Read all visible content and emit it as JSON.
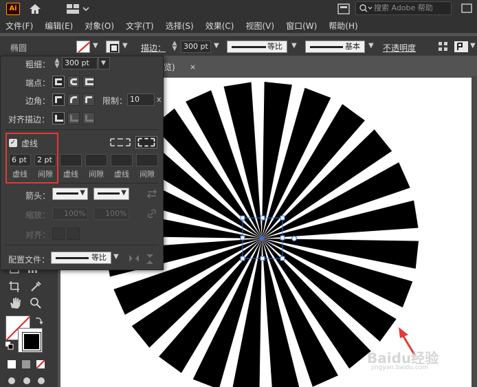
{
  "app": {
    "logo": "Ai",
    "search_placeholder": "搜索 Adobe 帮助",
    "icons": [
      "home-icon",
      "layout-switcher-icon",
      "search-icon",
      "panel-icon",
      "window-control-icon"
    ]
  },
  "menu": {
    "items": [
      "文件(F)",
      "编辑(E)",
      "对象(O)",
      "文字(T)",
      "选择(S)",
      "效果(C)",
      "视图(V)",
      "窗口(W)",
      "帮助(H)"
    ]
  },
  "control_bar": {
    "shape_name": "椭圆",
    "stroke_label": "描边：",
    "stroke_weight": "300 pt",
    "profile_label": "等比",
    "brush_label": "基本",
    "opacity_label": "不透明度"
  },
  "document_tab": {
    "title": "览)",
    "close": "×"
  },
  "stroke_panel": {
    "weight_label": "粗细：",
    "weight_value": "300 pt",
    "cap_label": "端点：",
    "corner_label": "边角：",
    "limit_label": "限制：",
    "limit_value": "10",
    "limit_unit": "x",
    "align_label": "对齐描边：",
    "dashed_label": "虚线",
    "dashed_checked": true,
    "dash_values": [
      "6 pt",
      "2 pt",
      "",
      "",
      "",
      ""
    ],
    "dash_captions": [
      "虚线",
      "间隙",
      "虚线",
      "间隙",
      "虚线",
      "间隙"
    ],
    "arrowhead_label": "箭头：",
    "scale_label": "缩放：",
    "scale_values": [
      "100%",
      "100%"
    ],
    "align_arrow_label": "对齐：",
    "profile_label": "配置文件：",
    "profile_value": "等比"
  },
  "canvas": {
    "artwork": "dashed-circle-starburst",
    "spoke_count": 24,
    "fill_color": "#000000",
    "selection_color": "#3d6fd6"
  },
  "annotations": {
    "highlight_color": "#e53935",
    "arrow_color": "#e53935"
  },
  "watermark": {
    "text": "Baidu经验",
    "sub": "jingyan.baidu.com"
  }
}
